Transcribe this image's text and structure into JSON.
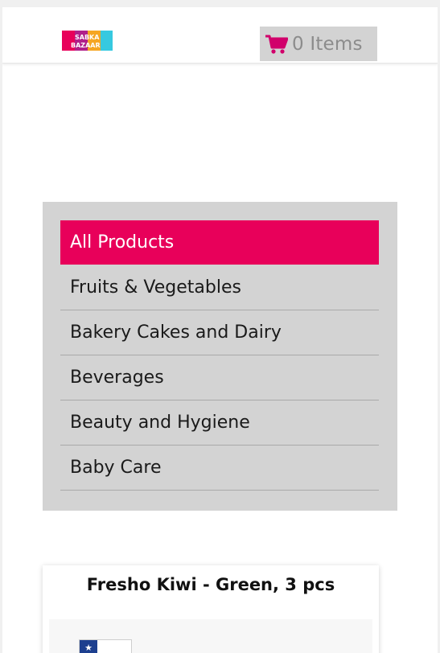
{
  "header": {
    "logo": {
      "line1": "SABKA",
      "line2": "BAZAAR",
      "colors": [
        "#e8005a",
        "#8b3fb0",
        "#f5a623",
        "#36c9e0"
      ]
    },
    "cart": {
      "label": "0 Items",
      "icon": "cart-icon",
      "icon_color": "#d1006b"
    }
  },
  "categories": {
    "items": [
      {
        "label": "All Products",
        "active": true
      },
      {
        "label": "Fruits & Vegetables",
        "active": false
      },
      {
        "label": "Bakery Cakes and Dairy",
        "active": false
      },
      {
        "label": "Beverages",
        "active": false
      },
      {
        "label": "Beauty and Hygiene",
        "active": false
      },
      {
        "label": "Baby Care",
        "active": false
      }
    ],
    "active_color": "#e8005a",
    "panel_color": "#d3d3d3"
  },
  "products": [
    {
      "name": "Fresho Kiwi - Green, 3 pcs"
    }
  ]
}
